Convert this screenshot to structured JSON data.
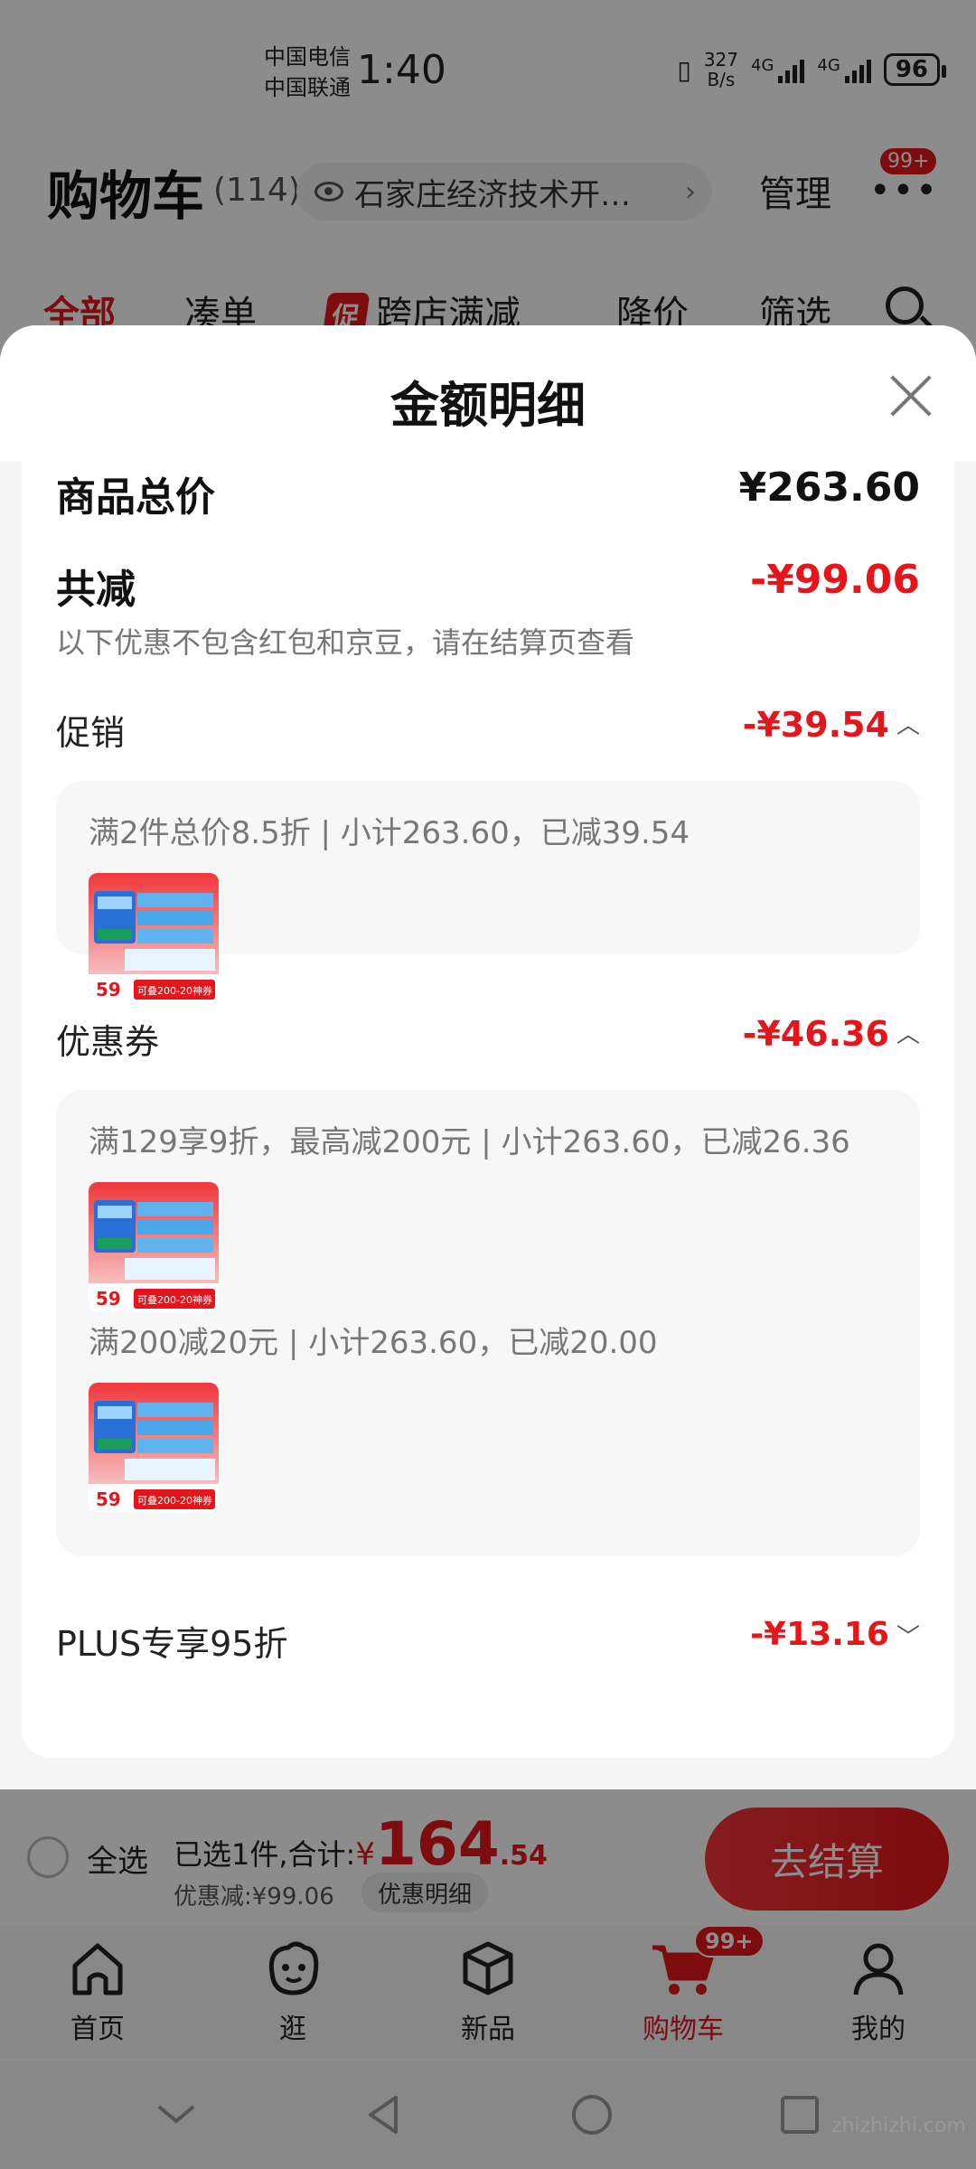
{
  "status_bar": {
    "carrier_1": "中国电信",
    "carrier_2": "中国联通",
    "time": "1:40",
    "net_speed": "327",
    "net_unit": "B/s",
    "network_1": "4G",
    "network_2": "4G",
    "battery": "96"
  },
  "cart_header": {
    "title": "购物车",
    "count": "(114)",
    "address": "石家庄经济技术开…",
    "manage_label": "管理",
    "more_badge": "99+"
  },
  "filter_tabs": {
    "all": "全部",
    "bundle": "凑单",
    "promo_tag": "促",
    "cross_store": "跨店满减",
    "price_drop": "降价",
    "filter": "筛选"
  },
  "sheet": {
    "title": "金额明细",
    "goods_total_label": "商品总价",
    "goods_total_value": "¥263.60",
    "total_reduce_label": "共减",
    "total_reduce_value": "-¥99.06",
    "note": "以下优惠不包含红包和京豆，请在结算页查看",
    "promotion": {
      "label": "促销",
      "value": "-¥39.54",
      "rule": "满2件总价8.5折 | 小计263.60，已减39.54"
    },
    "coupon": {
      "label": "优惠券",
      "value": "-¥46.36",
      "rule_1": "满129享9折，最高减200元 | 小计263.60，已减26.36",
      "rule_2": "满200减20元 | 小计263.60，已减20.00"
    },
    "plus": {
      "label": "PLUS专享95折",
      "value": "-¥13.16"
    },
    "thumb": {
      "price": "59",
      "coupon_text": "可叠200-20神券"
    }
  },
  "checkout": {
    "select_all": "全选",
    "summary_prefix": "已选1件,合计:",
    "yen": "¥",
    "amount_int": "164",
    "amount_dec": ".54",
    "discount": "优惠减:¥99.06",
    "detail_button": "优惠明细",
    "checkout_button": "去结算"
  },
  "tabbar": {
    "home": "首页",
    "browse": "逛",
    "new": "新品",
    "cart": "购物车",
    "cart_badge": "99+",
    "mine": "我的"
  },
  "watermark": "zhizhizhi.com",
  "colors": {
    "accent": "#e4161c",
    "sheet_bg": "#f5f5f5",
    "box_bg": "#f7f7f7"
  }
}
